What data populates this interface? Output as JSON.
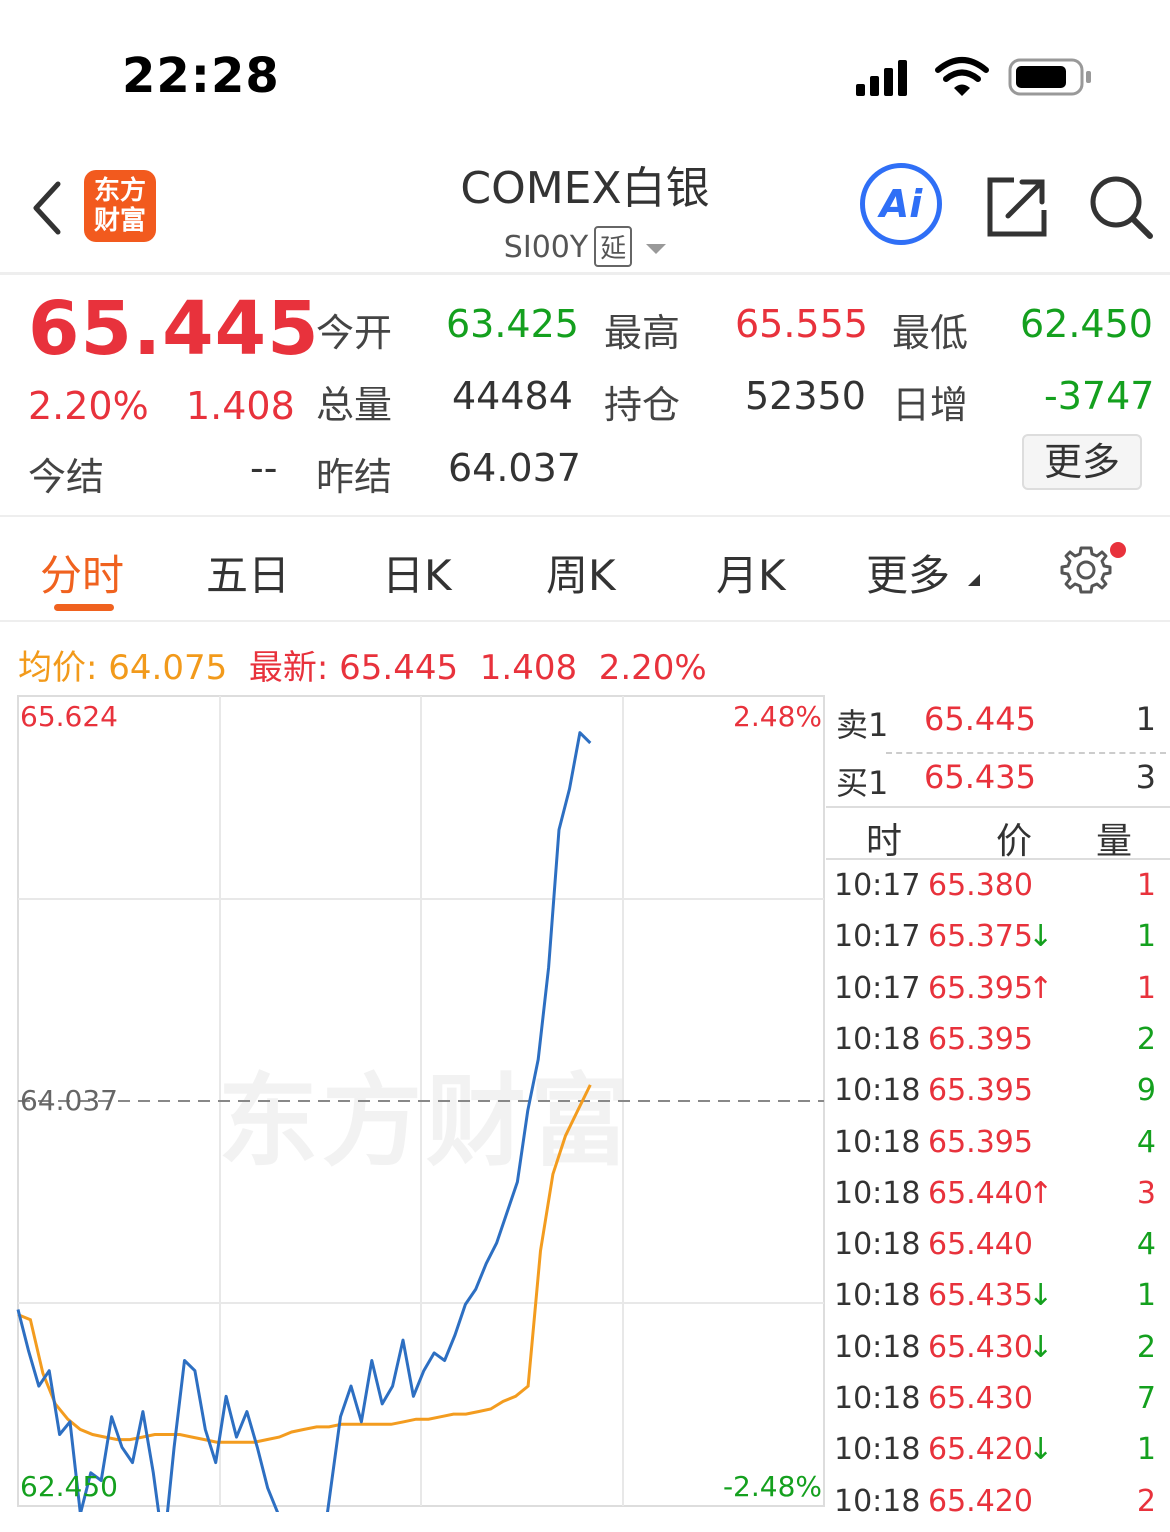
{
  "status_bar": {
    "time": "22:28"
  },
  "header": {
    "logo_text_line1": "东方",
    "logo_text_line2": "财富",
    "title": "COMEX白银",
    "code": "SI00Y",
    "delay_tag": "延",
    "ai_label": "Ai"
  },
  "quote": {
    "price": "65.445",
    "change_pct": "2.20%",
    "change": "1.408",
    "settle_label": "今结",
    "settle_value": "--",
    "fields": [
      {
        "label": "今开",
        "value": "63.425",
        "color": "green"
      },
      {
        "label": "最高",
        "value": "65.555",
        "color": "red"
      },
      {
        "label": "最低",
        "value": "62.450",
        "color": "green"
      },
      {
        "label": "总量",
        "value": "44484",
        "color": "dark"
      },
      {
        "label": "持仓",
        "value": "52350",
        "color": "dark"
      },
      {
        "label": "日增",
        "value": "-3747",
        "color": "green"
      },
      {
        "label": "昨结",
        "value": "64.037",
        "color": "dark"
      }
    ],
    "more_button": "更多"
  },
  "tabs": [
    {
      "label": "分时",
      "active": true
    },
    {
      "label": "五日",
      "active": false
    },
    {
      "label": "日K",
      "active": false
    },
    {
      "label": "周K",
      "active": false
    },
    {
      "label": "月K",
      "active": false
    },
    {
      "label": "更多",
      "active": false
    }
  ],
  "summary": {
    "avg_label": "均价:",
    "avg_value": "64.075",
    "latest_label": "最新:",
    "latest_value": "65.445",
    "latest_change": "1.408",
    "latest_pct": "2.20%"
  },
  "chart_data": {
    "type": "line",
    "y_axis_labels": {
      "top": "65.624",
      "mid": "64.037",
      "bottom": "62.450"
    },
    "pct_labels": {
      "top": "2.48%",
      "bottom": "-2.48%"
    },
    "ylim": [
      62.45,
      65.624
    ],
    "reference": 64.037,
    "watermark": "东方财富",
    "series": [
      {
        "color": "#2d6fc2",
        "values": [
          63.22,
          63.06,
          62.92,
          62.98,
          62.73,
          62.78,
          62.42,
          62.58,
          62.55,
          62.8,
          62.68,
          62.62,
          62.82,
          62.58,
          62.28,
          62.68,
          63.02,
          62.98,
          62.75,
          62.62,
          62.88,
          62.72,
          62.82,
          62.68,
          62.52,
          62.42,
          62.3,
          62.34,
          62.22,
          62.2,
          62.5,
          62.8,
          62.92,
          62.78,
          63.02,
          62.85,
          62.92,
          63.1,
          62.88,
          62.98,
          63.05,
          63.02,
          63.12,
          63.24,
          63.3,
          63.4,
          63.48,
          63.6,
          63.72,
          64.0,
          64.2,
          64.56,
          65.1,
          65.26,
          65.48,
          65.44
        ]
      },
      {
        "color": "#f39c1f",
        "values": [
          63.2,
          63.18,
          62.97,
          62.85,
          62.79,
          62.75,
          62.73,
          62.72,
          62.71,
          62.71,
          62.72,
          62.73,
          62.73,
          62.73,
          62.72,
          62.71,
          62.7,
          62.7,
          62.7,
          62.7,
          62.71,
          62.72,
          62.74,
          62.75,
          62.76,
          62.76,
          62.77,
          62.77,
          62.77,
          62.77,
          62.77,
          62.78,
          62.79,
          62.79,
          62.8,
          62.81,
          62.81,
          62.82,
          62.83,
          62.86,
          62.88,
          62.92,
          63.45,
          63.75,
          63.9,
          64.0,
          64.1
        ]
      }
    ]
  },
  "order_book": {
    "sell": {
      "label": "卖1",
      "price": "65.445",
      "qty": "1"
    },
    "buy": {
      "label": "买1",
      "price": "65.435",
      "qty": "3"
    }
  },
  "trades_header": {
    "time": "时",
    "price": "价",
    "qty": "量"
  },
  "trades": [
    {
      "time": "10:17",
      "price": "65.380",
      "arrow": "",
      "qty": "1",
      "qty_color": "red"
    },
    {
      "time": "10:17",
      "price": "65.375",
      "arrow": "↓",
      "qty": "1",
      "qty_color": "green"
    },
    {
      "time": "10:17",
      "price": "65.395",
      "arrow": "↑",
      "qty": "1",
      "qty_color": "red"
    },
    {
      "time": "10:18",
      "price": "65.395",
      "arrow": "",
      "qty": "2",
      "qty_color": "green"
    },
    {
      "time": "10:18",
      "price": "65.395",
      "arrow": "",
      "qty": "9",
      "qty_color": "green"
    },
    {
      "time": "10:18",
      "price": "65.395",
      "arrow": "",
      "qty": "4",
      "qty_color": "green"
    },
    {
      "time": "10:18",
      "price": "65.440",
      "arrow": "↑",
      "qty": "3",
      "qty_color": "red"
    },
    {
      "time": "10:18",
      "price": "65.440",
      "arrow": "",
      "qty": "4",
      "qty_color": "green"
    },
    {
      "time": "10:18",
      "price": "65.435",
      "arrow": "↓",
      "qty": "1",
      "qty_color": "green"
    },
    {
      "time": "10:18",
      "price": "65.430",
      "arrow": "↓",
      "qty": "2",
      "qty_color": "green"
    },
    {
      "time": "10:18",
      "price": "65.430",
      "arrow": "",
      "qty": "7",
      "qty_color": "green"
    },
    {
      "time": "10:18",
      "price": "65.420",
      "arrow": "↓",
      "qty": "1",
      "qty_color": "green"
    },
    {
      "time": "10:18",
      "price": "65.420",
      "arrow": "",
      "qty": "2",
      "qty_color": "red"
    }
  ],
  "colors": {
    "red": "#e8323c",
    "green": "#14a01e",
    "orange": "#f0621f",
    "blue": "#2f6ff6"
  }
}
